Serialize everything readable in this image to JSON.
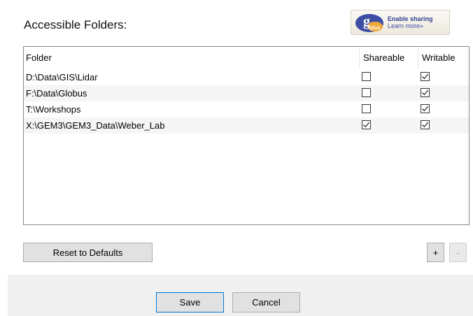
{
  "dialog": {
    "title": "Accessible Folders:"
  },
  "globus_badge": {
    "logo_letter": "g",
    "logo_word": "plus",
    "line1": "Enable sharing",
    "line2": "Learn more»"
  },
  "table": {
    "headers": {
      "folder": "Folder",
      "shareable": "Shareable",
      "writable": "Writable"
    },
    "rows": [
      {
        "folder": "D:\\Data\\GIS\\Lidar",
        "shareable": false,
        "writable": true
      },
      {
        "folder": "F:\\Data\\Globus",
        "shareable": false,
        "writable": true
      },
      {
        "folder": "T:\\Workshops",
        "shareable": false,
        "writable": true
      },
      {
        "folder": "X:\\GEM3\\GEM3_Data\\Weber_Lab",
        "shareable": true,
        "writable": true
      }
    ]
  },
  "buttons": {
    "reset": "Reset to Defaults",
    "add": "+",
    "remove": "-",
    "save": "Save",
    "cancel": "Cancel"
  },
  "colors": {
    "primary_button_border": "#0078d7",
    "footer_background": "#f0f0f0",
    "alt_row_background": "#f5f5f5"
  }
}
